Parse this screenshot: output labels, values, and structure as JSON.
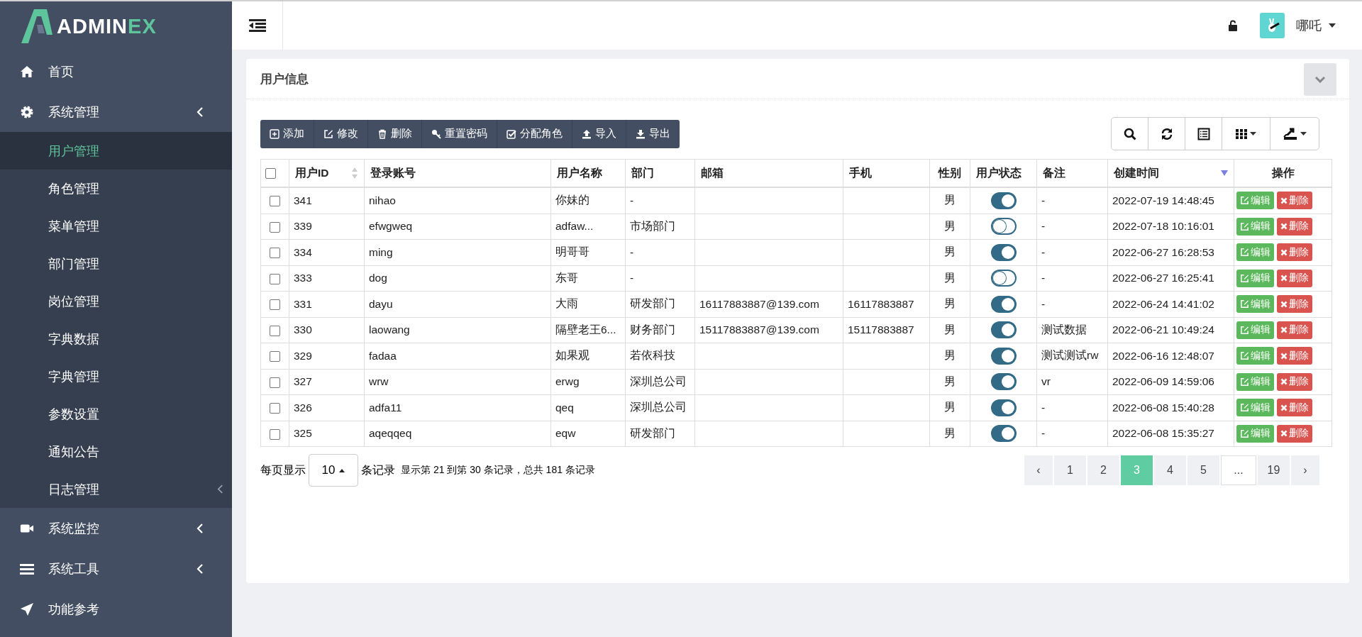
{
  "logo": {
    "main": "ADMIN",
    "accent": "EX"
  },
  "sidebar": {
    "items": [
      {
        "kind": "home",
        "label": "首页",
        "expandable": false
      },
      {
        "kind": "gear",
        "label": "系统管理",
        "expandable": true,
        "expanded": true,
        "children": [
          {
            "label": "用户管理",
            "selected": true,
            "expandable": false
          },
          {
            "label": "角色管理",
            "selected": false,
            "expandable": false
          },
          {
            "label": "菜单管理",
            "selected": false,
            "expandable": false
          },
          {
            "label": "部门管理",
            "selected": false,
            "expandable": false
          },
          {
            "label": "岗位管理",
            "selected": false,
            "expandable": false
          },
          {
            "label": "字典数据",
            "selected": false,
            "expandable": false
          },
          {
            "label": "字典管理",
            "selected": false,
            "expandable": false
          },
          {
            "label": "参数设置",
            "selected": false,
            "expandable": false
          },
          {
            "label": "通知公告",
            "selected": false,
            "expandable": false
          },
          {
            "label": "日志管理",
            "selected": false,
            "expandable": true
          }
        ]
      },
      {
        "kind": "video",
        "label": "系统监控",
        "expandable": true
      },
      {
        "kind": "bars",
        "label": "系统工具",
        "expandable": true
      },
      {
        "kind": "send",
        "label": "功能参考",
        "expandable": false
      }
    ]
  },
  "topbar": {
    "user": "哪吒"
  },
  "panel": {
    "title": "用户信息"
  },
  "toolbar": [
    {
      "kind": "add",
      "label": "添加"
    },
    {
      "kind": "edit",
      "label": "修改"
    },
    {
      "kind": "delete",
      "label": "删除"
    },
    {
      "kind": "key",
      "label": "重置密码"
    },
    {
      "kind": "check",
      "label": "分配角色"
    },
    {
      "kind": "upload",
      "label": "导入"
    },
    {
      "kind": "download",
      "label": "导出"
    }
  ],
  "table": {
    "all_checked": false,
    "columns": [
      {
        "label": "用户ID",
        "sortable": true
      },
      {
        "label": "登录账号"
      },
      {
        "label": "用户名称"
      },
      {
        "label": "部门"
      },
      {
        "label": "邮箱"
      },
      {
        "label": "手机"
      },
      {
        "label": "性别"
      },
      {
        "label": "用户状态"
      },
      {
        "label": "备注"
      },
      {
        "label": "创建时间",
        "sorted_desc": true
      },
      {
        "label": "操作"
      }
    ],
    "rows": [
      {
        "checked": false,
        "id": "341",
        "account": "nihao",
        "name": "你妹的",
        "dept": "-",
        "email": "",
        "phone": "",
        "gender": "男",
        "on": true,
        "note": "-",
        "created": "2022-07-19 14:48:45",
        "edit": "编辑",
        "delete": "删除"
      },
      {
        "checked": false,
        "id": "339",
        "account": "efwgweq",
        "name": "adfaw...",
        "dept": "市场部门",
        "email": "",
        "phone": "",
        "gender": "男",
        "on": false,
        "note": "-",
        "created": "2022-07-18 10:16:01",
        "edit": "编辑",
        "delete": "删除"
      },
      {
        "checked": false,
        "id": "334",
        "account": "ming",
        "name": "明哥哥",
        "dept": "-",
        "email": "",
        "phone": "",
        "gender": "男",
        "on": true,
        "note": "-",
        "created": "2022-06-27 16:28:53",
        "edit": "编辑",
        "delete": "删除"
      },
      {
        "checked": false,
        "id": "333",
        "account": "dog",
        "name": "东哥",
        "dept": "-",
        "email": "",
        "phone": "",
        "gender": "男",
        "on": false,
        "note": "-",
        "created": "2022-06-27 16:25:41",
        "edit": "编辑",
        "delete": "删除"
      },
      {
        "checked": false,
        "id": "331",
        "account": "dayu",
        "name": "大雨",
        "dept": "研发部门",
        "email": "16117883887@139.com",
        "phone": "16117883887",
        "gender": "男",
        "on": true,
        "note": "-",
        "created": "2022-06-24 14:41:02",
        "edit": "编辑",
        "delete": "删除"
      },
      {
        "checked": false,
        "id": "330",
        "account": "laowang",
        "name": "隔壁老王6...",
        "dept": "财务部门",
        "email": "15117883887@139.com",
        "phone": "15117883887",
        "gender": "男",
        "on": true,
        "note": "测试数据",
        "created": "2022-06-21 10:49:24",
        "edit": "编辑",
        "delete": "删除"
      },
      {
        "checked": false,
        "id": "329",
        "account": "fadaa",
        "name": "如果观",
        "dept": "若依科技",
        "email": "",
        "phone": "",
        "gender": "男",
        "on": true,
        "note": "测试测试rw",
        "created": "2022-06-16 12:48:07",
        "edit": "编辑",
        "delete": "删除"
      },
      {
        "checked": false,
        "id": "327",
        "account": "wrw",
        "name": "erwg",
        "dept": "深圳总公司",
        "email": "",
        "phone": "",
        "gender": "男",
        "on": true,
        "note": "vr",
        "created": "2022-06-09 14:59:06",
        "edit": "编辑",
        "delete": "删除"
      },
      {
        "checked": false,
        "id": "326",
        "account": "adfa11",
        "name": "qeq",
        "dept": "深圳总公司",
        "email": "",
        "phone": "",
        "gender": "男",
        "on": true,
        "note": "-",
        "created": "2022-06-08 15:40:28",
        "edit": "编辑",
        "delete": "删除"
      },
      {
        "checked": false,
        "id": "325",
        "account": "aqeqqeq",
        "name": "eqw",
        "dept": "研发部门",
        "email": "",
        "phone": "",
        "gender": "男",
        "on": true,
        "note": "-",
        "created": "2022-06-08 15:35:27",
        "edit": "编辑",
        "delete": "删除"
      }
    ]
  },
  "pagination": {
    "per_page_label": "每页显示",
    "per_page": "10",
    "records_label": "条记录",
    "summary": "显示第 21 到第 30 条记录，总共 181 条记录",
    "pages": [
      {
        "kind": "nav",
        "label": "‹",
        "selected": false
      },
      {
        "kind": "page",
        "label": "1",
        "selected": false
      },
      {
        "kind": "page",
        "label": "2",
        "selected": false
      },
      {
        "kind": "page",
        "label": "3",
        "selected": true
      },
      {
        "kind": "page",
        "label": "4",
        "selected": false
      },
      {
        "kind": "page",
        "label": "5",
        "selected": false
      },
      {
        "kind": "gap",
        "label": "...",
        "selected": false
      },
      {
        "kind": "page",
        "label": "19",
        "selected": false
      },
      {
        "kind": "nav",
        "label": "›",
        "selected": false
      }
    ]
  }
}
